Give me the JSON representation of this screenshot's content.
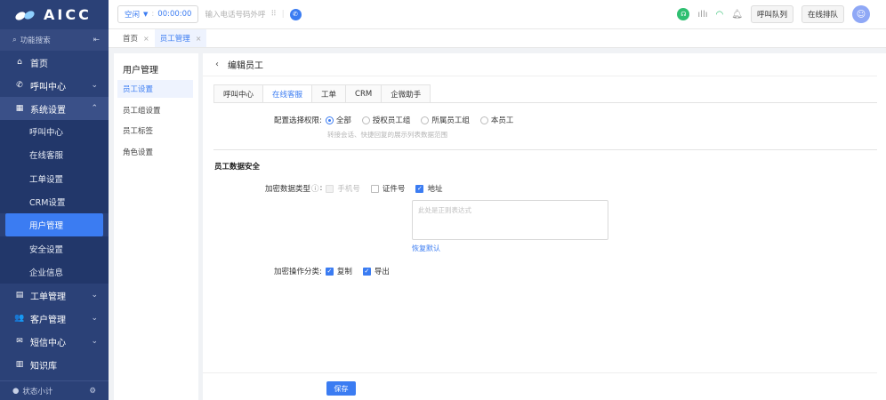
{
  "brand": {
    "name": "AICC"
  },
  "sidebar": {
    "search_label": "功能搜索",
    "menu": [
      {
        "label": "首页"
      },
      {
        "label": "呼叫中心"
      },
      {
        "label": "系统设置"
      },
      {
        "label": "工单管理"
      },
      {
        "label": "客户管理"
      },
      {
        "label": "短信中心"
      },
      {
        "label": "知识库"
      }
    ],
    "sub_items": [
      "呼叫中心",
      "在线客服",
      "工单设置",
      "CRM设置",
      "用户管理",
      "安全设置",
      "企业信息"
    ],
    "footer_label": "状态小计"
  },
  "topbar": {
    "status_label": "空闲",
    "timer": "00:00:00",
    "dial_placeholder": "输入电话号码外呼",
    "queue_button": "呼叫队列",
    "online_button": "在线排队"
  },
  "page_tabs": [
    {
      "label": "首页"
    },
    {
      "label": "员工管理"
    }
  ],
  "subnav": {
    "title": "用户管理",
    "items": [
      "员工设置",
      "员工组设置",
      "员工标签",
      "角色设置"
    ]
  },
  "main": {
    "title": "编辑员工",
    "tabs": [
      "呼叫中心",
      "在线客服",
      "工单",
      "CRM",
      "企微助手"
    ],
    "permission": {
      "label": "配置选择权限:",
      "options": [
        "全部",
        "授权员工组",
        "所属员工组",
        "本员工"
      ],
      "selected": "全部",
      "hint": "转接会话、快捷回复的展示列表数据范围"
    },
    "security": {
      "section_title": "员工数据安全",
      "encrypt_type_label": "加密数据类型",
      "encrypt_types": [
        {
          "label": "手机号",
          "checked": false,
          "disabled": true
        },
        {
          "label": "证件号",
          "checked": false,
          "disabled": false
        },
        {
          "label": "地址",
          "checked": true,
          "disabled": false
        }
      ],
      "regex_placeholder": "此处是正则表达式",
      "restore_label": "恢复默认",
      "encrypt_op_label": "加密操作分类:",
      "encrypt_ops": [
        {
          "label": "复制",
          "checked": true
        },
        {
          "label": "导出",
          "checked": true
        }
      ]
    },
    "save_label": "保存"
  },
  "colors": {
    "sidebar": "#2b4177",
    "accent": "#3b7cf2"
  }
}
